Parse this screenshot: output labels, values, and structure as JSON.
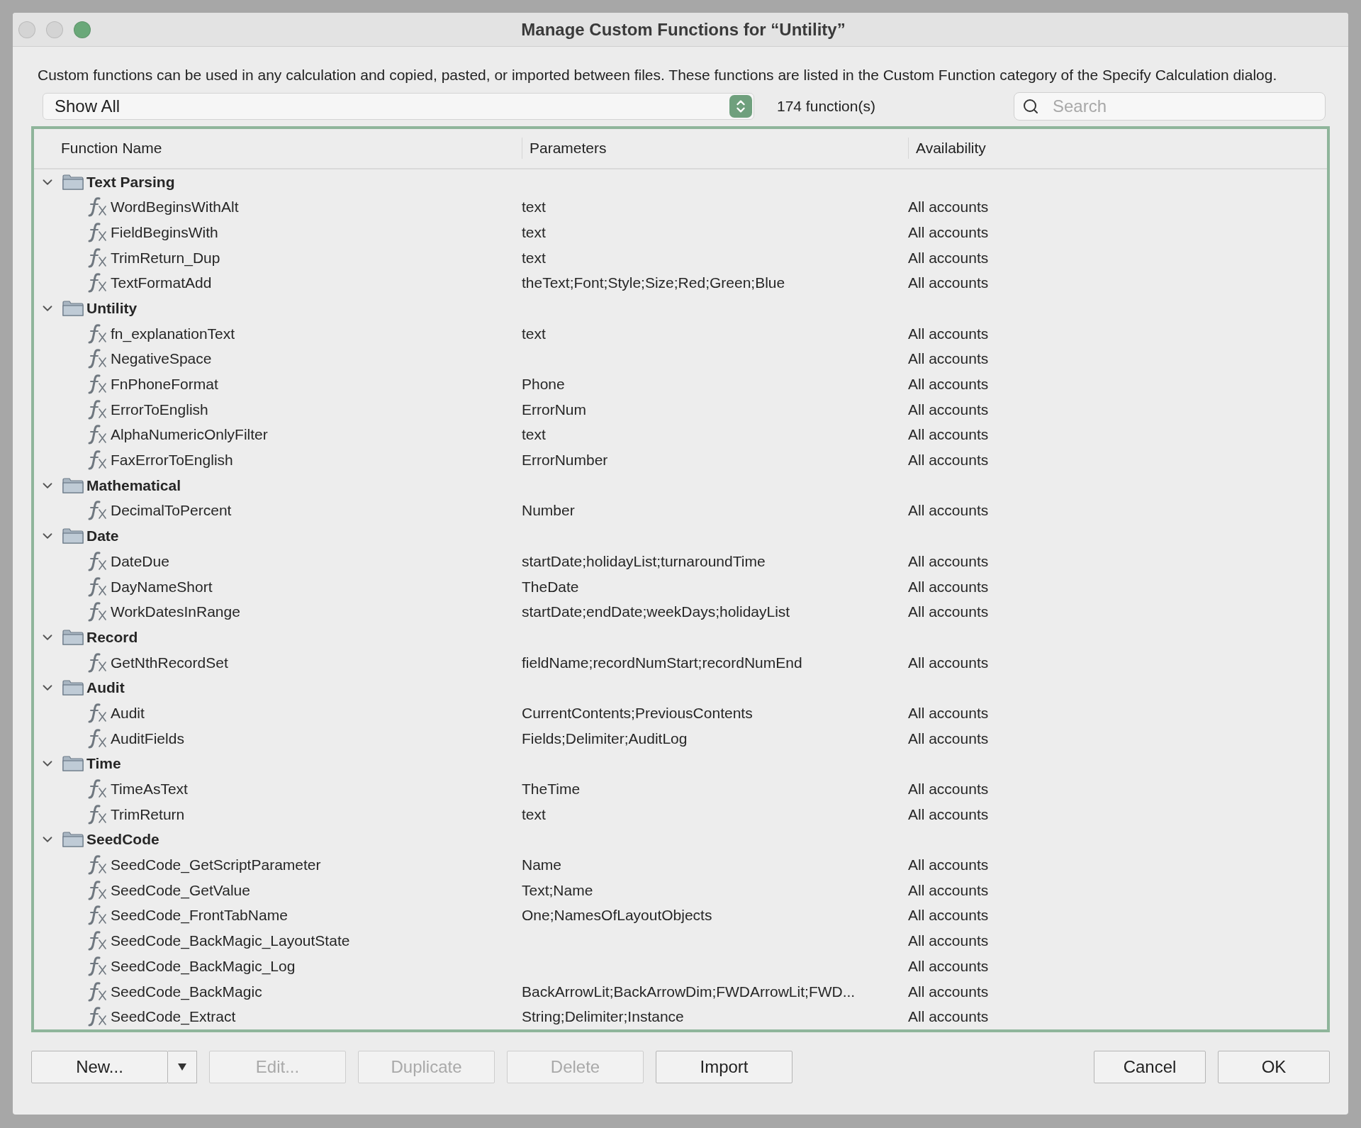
{
  "window": {
    "title": "Manage Custom Functions for “Untility”"
  },
  "description": "Custom functions can be used in any calculation and copied, pasted, or imported between files. These functions are listed in the Custom Function category of the Specify Calculation dialog.",
  "filter": {
    "value": "Show All"
  },
  "count": "174 function(s)",
  "search": {
    "placeholder": "Search"
  },
  "table": {
    "columns": [
      "Function Name",
      "Parameters",
      "Availability"
    ],
    "groups": [
      {
        "name": "Text Parsing",
        "expanded": true,
        "functions": [
          {
            "name": "WordBeginsWithAlt",
            "parameters": "text",
            "availability": "All accounts"
          },
          {
            "name": "FieldBeginsWith",
            "parameters": "text",
            "availability": "All accounts"
          },
          {
            "name": "TrimReturn_Dup",
            "parameters": "text",
            "availability": "All accounts"
          },
          {
            "name": "TextFormatAdd",
            "parameters": "theText;Font;Style;Size;Red;Green;Blue",
            "availability": "All accounts"
          }
        ]
      },
      {
        "name": "Untility",
        "expanded": true,
        "functions": [
          {
            "name": "fn_explanationText",
            "parameters": "text",
            "availability": "All accounts"
          },
          {
            "name": "NegativeSpace",
            "availability": "All accounts"
          },
          {
            "name": "FnPhoneFormat",
            "parameters": "Phone",
            "availability": "All accounts"
          },
          {
            "name": "ErrorToEnglish",
            "parameters": "ErrorNum",
            "availability": "All accounts"
          },
          {
            "name": "AlphaNumericOnlyFilter",
            "parameters": "text",
            "availability": "All accounts"
          },
          {
            "name": "FaxErrorToEnglish",
            "parameters": "ErrorNumber",
            "availability": "All accounts"
          }
        ]
      },
      {
        "name": "Mathematical",
        "expanded": true,
        "functions": [
          {
            "name": "DecimalToPercent",
            "parameters": "Number",
            "availability": "All accounts"
          }
        ]
      },
      {
        "name": "Date",
        "expanded": true,
        "functions": [
          {
            "name": "DateDue",
            "parameters": "startDate;holidayList;turnaroundTime",
            "availability": "All accounts"
          },
          {
            "name": "DayNameShort",
            "parameters": "TheDate",
            "availability": "All accounts"
          },
          {
            "name": "WorkDatesInRange",
            "parameters": "startDate;endDate;weekDays;holidayList",
            "availability": "All accounts"
          }
        ]
      },
      {
        "name": "Record",
        "expanded": true,
        "functions": [
          {
            "name": "GetNthRecordSet",
            "parameters": "fieldName;recordNumStart;recordNumEnd",
            "availability": "All accounts"
          }
        ]
      },
      {
        "name": "Audit",
        "expanded": true,
        "functions": [
          {
            "name": "Audit",
            "parameters": "CurrentContents;PreviousContents",
            "availability": "All accounts"
          },
          {
            "name": "AuditFields",
            "parameters": "Fields;Delimiter;AuditLog",
            "availability": "All accounts"
          }
        ]
      },
      {
        "name": "Time",
        "expanded": true,
        "functions": [
          {
            "name": "TimeAsText",
            "parameters": "TheTime",
            "availability": "All accounts"
          },
          {
            "name": "TrimReturn",
            "parameters": "text",
            "availability": "All accounts"
          }
        ]
      },
      {
        "name": "SeedCode",
        "expanded": true,
        "functions": [
          {
            "name": "SeedCode_GetScriptParameter",
            "parameters": "Name",
            "availability": "All accounts"
          },
          {
            "name": "SeedCode_GetValue",
            "parameters": "Text;Name",
            "availability": "All accounts"
          },
          {
            "name": "SeedCode_FrontTabName",
            "parameters": "One;NamesOfLayoutObjects",
            "availability": "All accounts"
          },
          {
            "name": "SeedCode_BackMagic_LayoutState",
            "availability": "All accounts"
          },
          {
            "name": "SeedCode_BackMagic_Log",
            "availability": "All accounts"
          },
          {
            "name": "SeedCode_BackMagic",
            "parameters": "BackArrowLit;BackArrowDim;FWDArrowLit;FWD...",
            "availability": "All accounts"
          },
          {
            "name": "SeedCode_Extract",
            "parameters": "String;Delimiter;Instance",
            "availability": "All accounts"
          }
        ]
      }
    ]
  },
  "buttons_left": [
    {
      "label": "New...",
      "kind": "split",
      "disabled": false
    },
    {
      "label": "Edit...",
      "kind": "plain",
      "disabled": true
    },
    {
      "label": "Duplicate",
      "kind": "plain",
      "disabled": true
    },
    {
      "label": "Delete",
      "kind": "plain",
      "disabled": true
    },
    {
      "label": "Import",
      "kind": "plain",
      "disabled": false
    }
  ],
  "buttons_right": [
    {
      "label": "Cancel",
      "kind": "plain",
      "disabled": false
    },
    {
      "label": "OK",
      "kind": "plain",
      "disabled": false
    }
  ]
}
